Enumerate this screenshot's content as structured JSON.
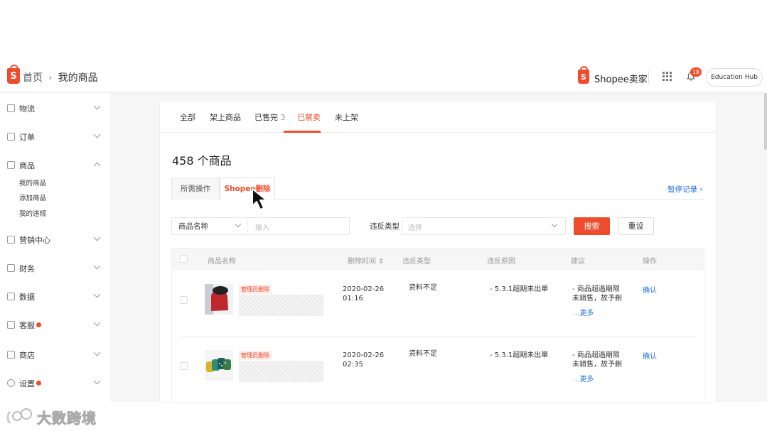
{
  "header": {
    "breadcrumb_home": "首页",
    "breadcrumb_sep": "›",
    "breadcrumb_current": "我的商品",
    "seller_name": "Shopee卖家",
    "notification_count": "18",
    "education_hub": "Education Hub"
  },
  "sidebar": {
    "items": [
      {
        "label": "物流",
        "icon": "truck-icon"
      },
      {
        "label": "订单",
        "icon": "clipboard-icon"
      },
      {
        "label": "商品",
        "icon": "bag-icon"
      },
      {
        "label": "营销中心",
        "icon": "tag-icon"
      },
      {
        "label": "财务",
        "icon": "wallet-icon"
      },
      {
        "label": "数据",
        "icon": "chart-icon"
      },
      {
        "label": "客服",
        "icon": "chat-icon"
      },
      {
        "label": "商店",
        "icon": "store-icon"
      },
      {
        "label": "设置",
        "icon": "gear-icon"
      }
    ],
    "sub_items": [
      "我的商品",
      "添加商品",
      "我的违规"
    ]
  },
  "tabs": [
    "全部",
    "架上商品",
    "已售完",
    "已禁卖",
    "未上架"
  ],
  "tab_soldout_count": "3",
  "active_tab": "已禁卖",
  "product_count": "458 个商品",
  "subtabs": [
    "所需操作",
    "Shopee删除"
  ],
  "history_link": "暂停记录",
  "filters": {
    "name_select": "商品名称",
    "name_placeholder": "输入",
    "violation_label": "违反类型",
    "violation_placeholder": "选择",
    "search_button": "搜索",
    "reset_button": "重设"
  },
  "table": {
    "headers": [
      "商品名称",
      "删除时间",
      "违反类型",
      "违反原因",
      "建议",
      "操作"
    ],
    "sort_indicator": "⇕",
    "rows": [
      {
        "tag": "管理员删除",
        "date": "2020-02-26",
        "time": "01:16",
        "violation_type": "资料不足",
        "reason": "- 5.3.1超期未出單",
        "suggest_line1": "- 商品超過期限",
        "suggest_line2": "未銷售，故予刪",
        "more": "...更多",
        "action": "确认"
      },
      {
        "tag": "管理员删除",
        "date": "2020-02-26",
        "time": "02:35",
        "violation_type": "资料不足",
        "reason": "- 5.3.1超期未出單",
        "suggest_line1": "- 商品超過期限",
        "suggest_line2": "未銷售，故予刪",
        "more": "...更多",
        "action": "确认"
      }
    ]
  },
  "watermark": "大数跨境",
  "colors": {
    "brand": "#ee4d2d",
    "link": "#2673dd"
  }
}
